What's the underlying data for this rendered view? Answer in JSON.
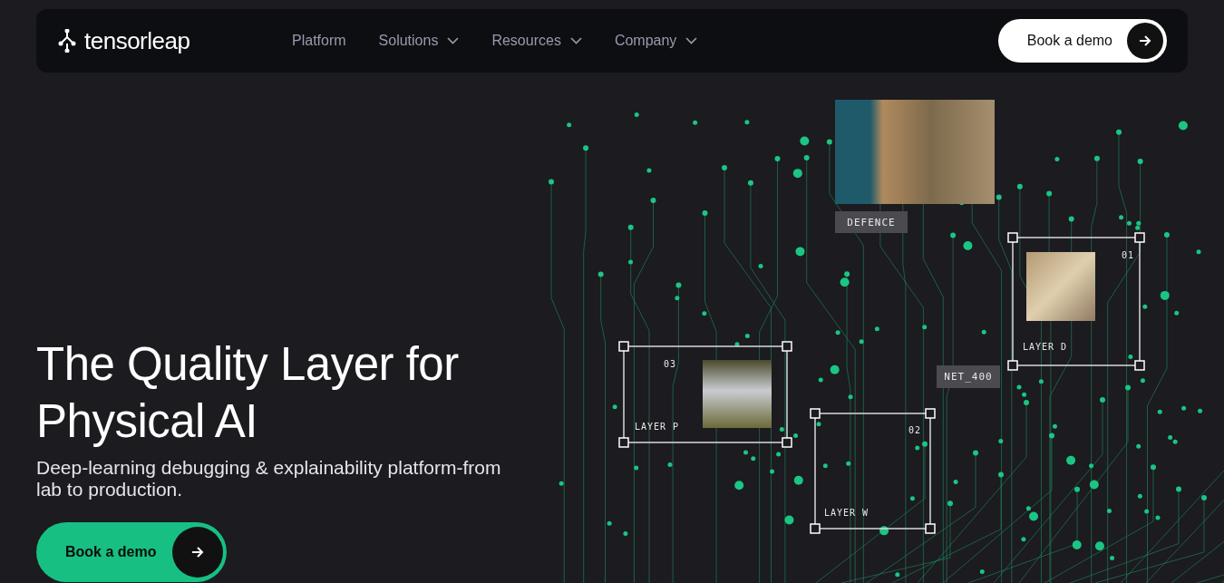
{
  "header": {
    "logo": "tensorleap",
    "nav": [
      {
        "label": "Platform",
        "dropdown": false
      },
      {
        "label": "Solutions",
        "dropdown": true
      },
      {
        "label": "Resources",
        "dropdown": true
      },
      {
        "label": "Company",
        "dropdown": true
      }
    ],
    "cta": "Book a demo"
  },
  "hero": {
    "headline": "The Quality Layer for Physical AI",
    "subtitle": "Deep-learning debugging & explainability platform-from lab to production.",
    "cta": "Book a demo"
  },
  "visual": {
    "tags": [
      {
        "label": "DEFENCE"
      },
      {
        "label": "NET_400"
      }
    ],
    "frames": [
      {
        "number": "01",
        "label": "LAYER D"
      },
      {
        "number": "03",
        "label": "LAYER P"
      },
      {
        "number": "02",
        "label": "LAYER W"
      }
    ]
  }
}
